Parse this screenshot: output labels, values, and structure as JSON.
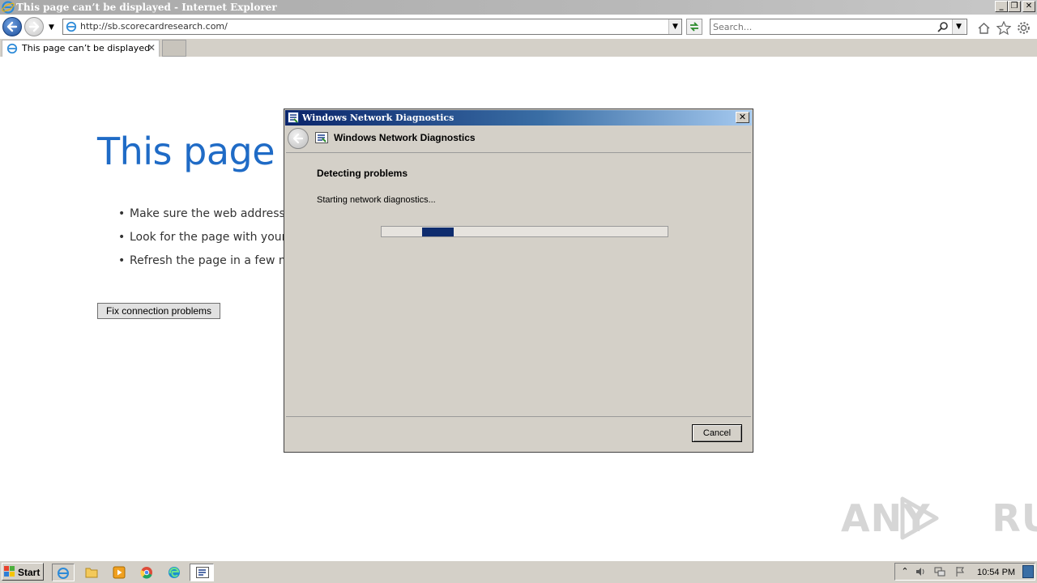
{
  "browser": {
    "window_title": "This page can’t be displayed - Internet Explorer",
    "address": "http://sb.scorecardresearch.com/",
    "search_placeholder": "Search...",
    "tab_title": "This page can’t be displayed"
  },
  "error_page": {
    "heading": "This page c",
    "bullets": [
      "Make sure the web address h",
      "Look for the page with your",
      "Refresh the page in a few mi"
    ],
    "fix_button": "Fix connection problems"
  },
  "dialog": {
    "title": "Windows Network Diagnostics",
    "header": "Windows Network Diagnostics",
    "heading": "Detecting problems",
    "status": "Starting network diagnostics...",
    "cancel_label": "Cancel",
    "progress_state": "marquee (indeterminate)"
  },
  "taskbar": {
    "start_label": "Start",
    "clock": "10:54 PM"
  },
  "watermark": {
    "text_left": "ANY",
    "text_right": "RUN"
  },
  "colors": {
    "heading_blue": "#1f6bc6",
    "dialog_title_start": "#0a246a",
    "progress_chunk": "#0e2c6e",
    "classic_gray": "#d4d0c8"
  },
  "icons": {
    "ie": "internet-explorer-icon",
    "back": "back-arrow-icon",
    "forward": "forward-arrow-icon",
    "home": "home-icon",
    "favorites": "star-icon",
    "tools": "gear-icon",
    "search": "magnifier-icon",
    "network_diag": "network-diagnostics-icon"
  }
}
